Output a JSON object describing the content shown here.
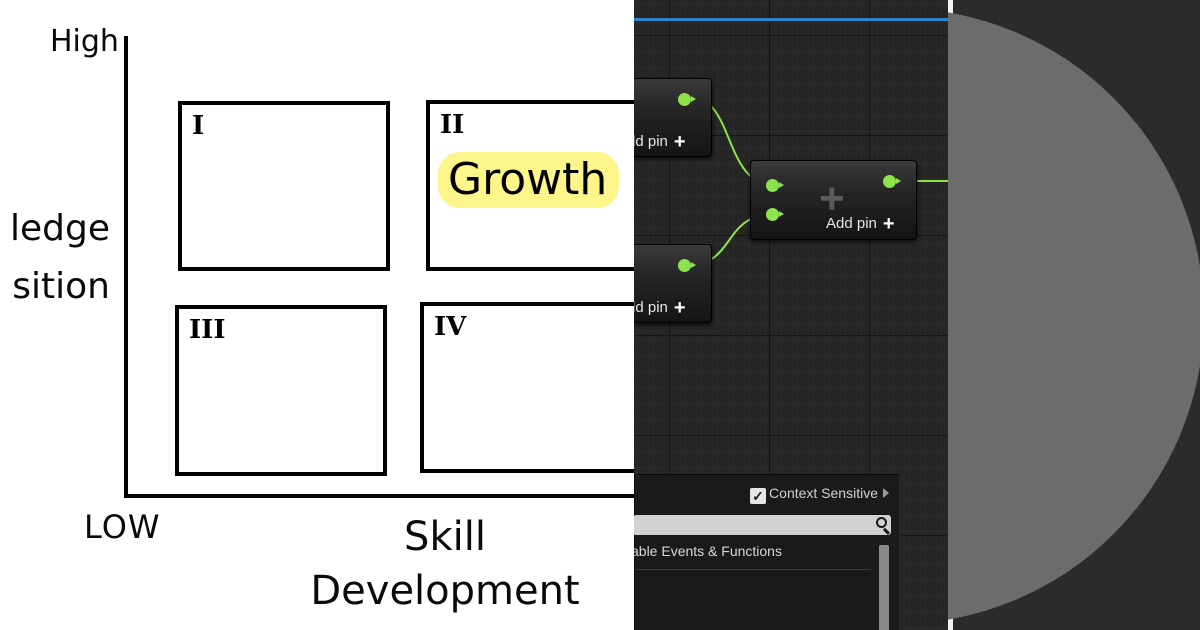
{
  "matrix": {
    "y_high": "High",
    "x_low": "LOW",
    "y_label_line1": "ledge",
    "y_label_line2": "sition",
    "x_label_line1": "Skill",
    "x_label_line2": "Development",
    "quadrants": [
      {
        "numeral": "I"
      },
      {
        "numeral": "II",
        "highlight": "Growth"
      },
      {
        "numeral": "III"
      },
      {
        "numeral": "IV"
      }
    ],
    "highlight_color": "#fbf58a"
  },
  "blueprint": {
    "nodes": [
      {
        "add_pin_label": "dd pin"
      },
      {
        "add_pin_label": "dd pin"
      },
      {
        "add_pin_label": "Add pin"
      }
    ],
    "pin_color": "#8ce34a",
    "accent_line_color": "#2a86c8",
    "context_menu": {
      "context_sensitive_label": "Context Sensitive",
      "context_sensitive_checked": true,
      "search_value": "",
      "list_item": "able Events & Functions"
    }
  }
}
